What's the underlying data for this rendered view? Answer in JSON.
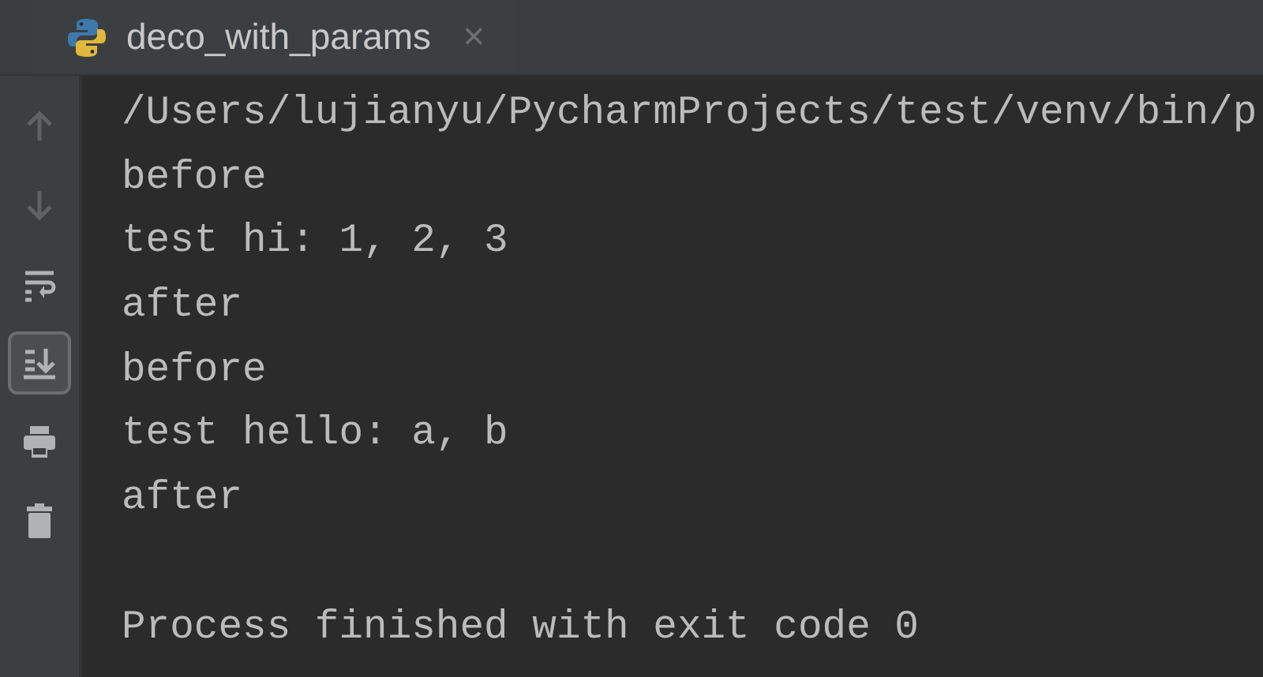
{
  "tabs": [
    {
      "label": "deco_with_params",
      "selected": true,
      "close": "×"
    }
  ],
  "toolbar": {
    "buttons": [
      {
        "kind": "up",
        "disabled": true,
        "on": false
      },
      {
        "kind": "down",
        "disabled": true,
        "on": false
      },
      {
        "kind": "wrap",
        "disabled": false,
        "on": false
      },
      {
        "kind": "scroll-end",
        "disabled": false,
        "on": true
      },
      {
        "kind": "print",
        "disabled": false,
        "on": false
      },
      {
        "kind": "trash",
        "disabled": false,
        "on": false
      }
    ]
  },
  "console": {
    "lines": [
      {
        "kind": "text",
        "text": "/Users/lujianyu/PycharmProjects/test/venv/bin/p"
      },
      {
        "kind": "text",
        "text": "before"
      },
      {
        "kind": "text",
        "text": "test hi: 1, 2, 3"
      },
      {
        "kind": "text",
        "text": "after"
      },
      {
        "kind": "text",
        "text": "before"
      },
      {
        "kind": "text",
        "text": "test hello: a, b"
      },
      {
        "kind": "text",
        "text": "after"
      },
      {
        "kind": "blank"
      },
      {
        "kind": "text",
        "text": "Process finished with exit code 0"
      }
    ]
  }
}
